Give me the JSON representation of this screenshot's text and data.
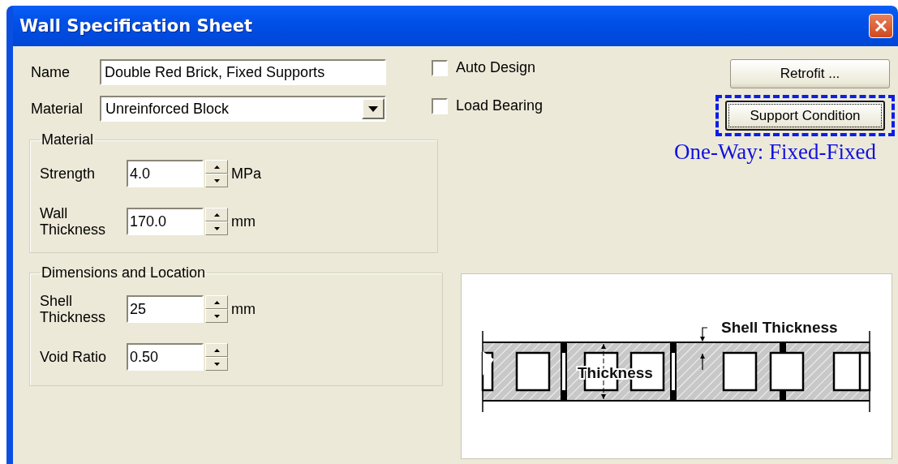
{
  "window": {
    "title": "Wall Specification Sheet"
  },
  "name_field": {
    "label": "Name",
    "value": "Double Red Brick, Fixed Supports"
  },
  "material_select": {
    "label": "Material",
    "value": "Unreinforced Block"
  },
  "checkboxes": [
    {
      "label": "Auto Design",
      "checked": false
    },
    {
      "label": "Load Bearing",
      "checked": false
    }
  ],
  "buttons": [
    {
      "label": "Retrofit ...",
      "focused": false
    },
    {
      "label": "Support Condition",
      "focused": true
    }
  ],
  "support_caption": "One-Way: Fixed-Fixed",
  "groups": [
    {
      "title": "Material",
      "rows": [
        {
          "label": "Strength",
          "value": "4.0",
          "unit": "MPa"
        },
        {
          "label": "Wall Thickness",
          "value": "170.0",
          "unit": "mm"
        }
      ]
    },
    {
      "title": "Dimensions and Location",
      "rows": [
        {
          "label": "Shell Thickness",
          "value": "25",
          "unit": "mm"
        },
        {
          "label": "Void Ratio",
          "value": "0.50"
        }
      ]
    }
  ],
  "diagram": {
    "labels": [
      "Shell Thickness",
      "Thickness"
    ]
  }
}
